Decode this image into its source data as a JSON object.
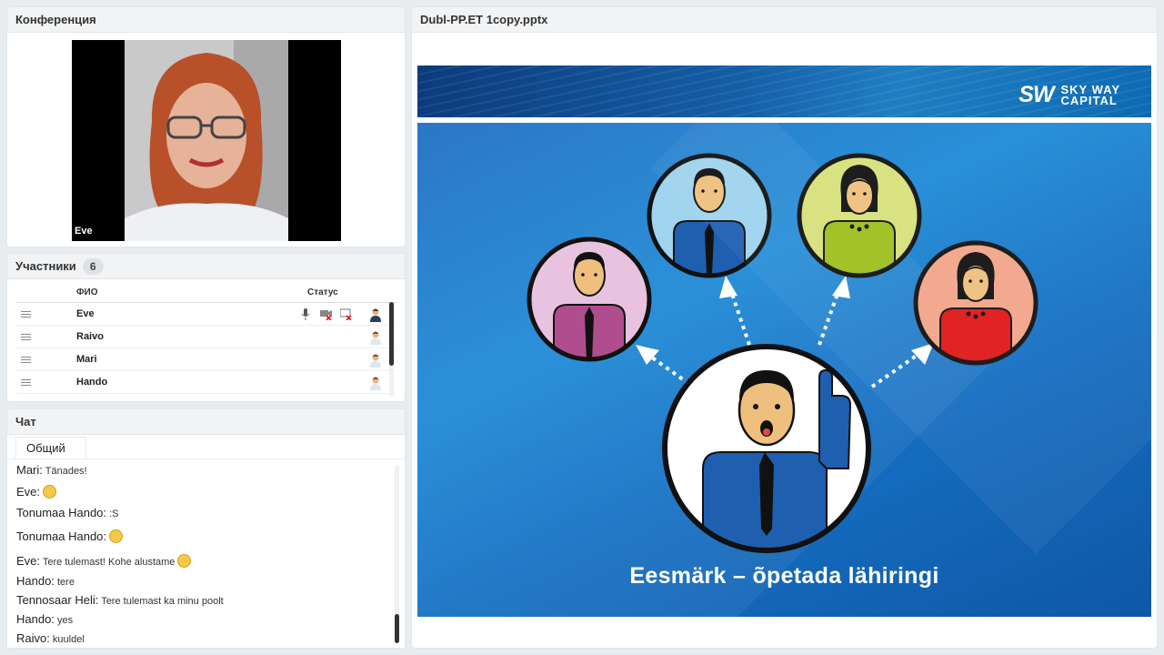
{
  "conference": {
    "title": "Конференция",
    "video_name": "Eve"
  },
  "participants": {
    "title": "Участники",
    "count": "6",
    "columns": {
      "name": "ФИО",
      "status": "Статус"
    },
    "rows": [
      {
        "name": "Eve",
        "status_icons": [
          "microphone-icon",
          "camera-off-icon",
          "screen-off-icon",
          "presenter-user-icon"
        ]
      },
      {
        "name": "Raivo",
        "status_icons": [
          "user-icon"
        ]
      },
      {
        "name": "Mari",
        "status_icons": [
          "user-icon"
        ]
      },
      {
        "name": "Hando",
        "status_icons": [
          "user-icon"
        ]
      }
    ]
  },
  "chat": {
    "title": "Чат",
    "tab": "Общий",
    "messages": [
      {
        "author": "Mari:",
        "text": "Tänades!"
      },
      {
        "author": "Eve:",
        "text": "",
        "emoji": "neutral-face"
      },
      {
        "author": "Tonumaa Hando:",
        "text": ":S"
      },
      {
        "author": "Tonumaa Hando:",
        "text": "",
        "emoji": "grin-face"
      },
      {
        "author": "Eve:",
        "text": "Tere tulemast! Kohe alustame",
        "emoji": "neutral-face"
      },
      {
        "author": "Hando:",
        "text": "tere"
      },
      {
        "author": "Tennosaar Heli:",
        "text": "Tere tulemast ka minu poolt"
      },
      {
        "author": "Hando:",
        "text": "yes"
      },
      {
        "author": "Raivo:",
        "text": "kuuldel"
      }
    ]
  },
  "presentation": {
    "file_name": "Dubl-PP.ET 1copy.pptx",
    "logo_mark": "SW",
    "logo_line1": "SKY WAY",
    "logo_line2": "CAPITAL",
    "caption": "Eesmärk – õpetada lähiringi"
  },
  "colors": {
    "panel_header": "#f1f3f5",
    "slide_blue": "#1e7ed0",
    "figure_outline": "#111111"
  }
}
